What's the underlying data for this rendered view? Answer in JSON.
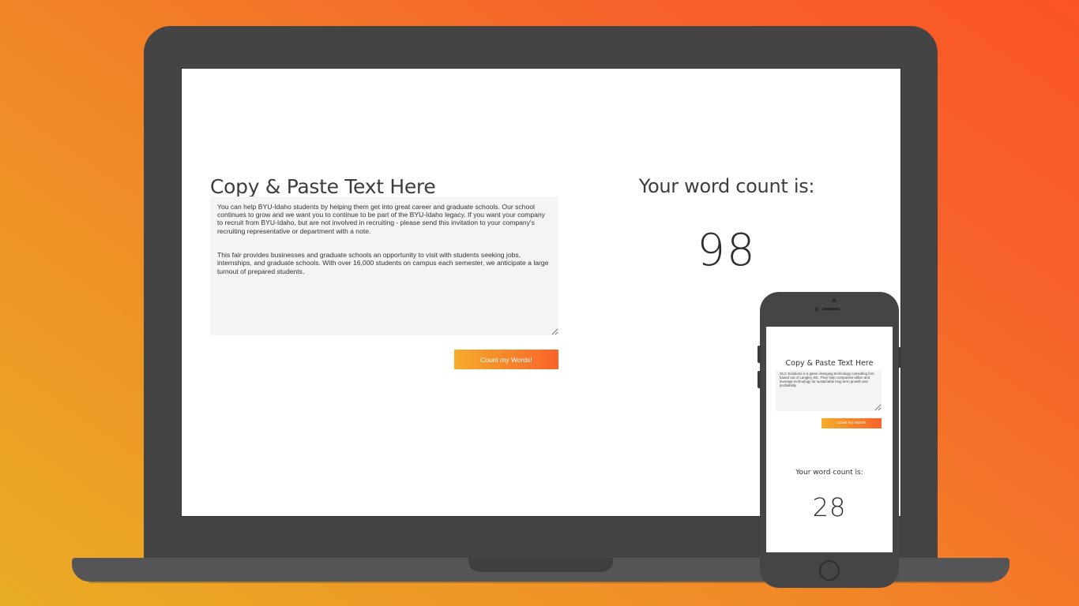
{
  "desktop": {
    "heading": "Copy & Paste Text Here",
    "textarea_value": "You can help BYU-Idaho students by helping them get into great career and graduate schools. Our school continues to grow and we want you to continue to be part of the BYU-Idaho legacy. If you want your company to recruit from BYU-Idaho, but are not involved in recruiting - please send this invitation to your company's recruiting representative or department with a note.\n\n\nThis fair provides businesses and graduate schools an opportunity to visit with students seeking jobs, internships, and graduate schools. With over 16,000 students on campus each semester, we anticipate a large turnout of prepared students.",
    "button_label": "Count my Words!",
    "result_title": "Your word count is:",
    "word_count": "98"
  },
  "mobile": {
    "heading": "Copy & Paste Text Here",
    "textarea_value": "GLC Solutions is a game changing technology consulting firm based out of Langley, BC. They help companies utilize and leverage technology for sustainable long term growth and profitability.",
    "button_label": "Count my Words!",
    "result_title": "Your word count is:",
    "word_count": "28"
  },
  "colors": {
    "background_start": "#e9ad25",
    "background_end": "#fb5523",
    "button_gradient_start": "#f5ac2b",
    "button_gradient_end": "#f8632a",
    "device_frame": "#444444"
  }
}
